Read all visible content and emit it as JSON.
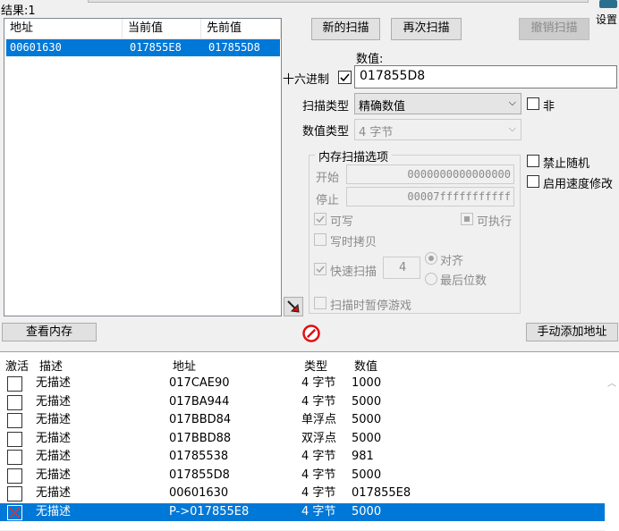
{
  "results_label": "结果:1",
  "settings_label": "设置",
  "found_list": {
    "columns": [
      "地址",
      "当前值",
      "先前值"
    ],
    "rows": [
      {
        "address": "00601630",
        "current": "017855E8",
        "previous": "017855D8"
      }
    ]
  },
  "buttons": {
    "new_scan": "新的扫描",
    "next_scan": "再次扫描",
    "undo_scan": "撤销扫描",
    "view_memory": "查看内存",
    "add_address_manually": "手动添加地址"
  },
  "value": {
    "label": "数值:",
    "hex_label": "十六进制",
    "hex_checked": true,
    "input": "017855D8"
  },
  "scan_type": {
    "label": "扫描类型",
    "selected": "精确数值",
    "not_label": "非"
  },
  "value_type": {
    "label": "数值类型",
    "selected": "4 字节"
  },
  "memory_options": {
    "title": "内存扫描选项",
    "start_label": "开始",
    "start_value": "0000000000000000",
    "stop_label": "停止",
    "stop_value": "00007fffffffffff",
    "writable_label": "可写",
    "executable_label": "可执行",
    "copy_on_write_label": "写时拷贝",
    "fast_scan_label": "快速扫描",
    "fast_scan_value": "4",
    "align_label": "对齐",
    "last_digits_label": "最后位数",
    "pause_game_label": "扫描时暂停游戏"
  },
  "side_options": {
    "disable_random": "禁止随机",
    "enable_speedhack": "启用速度修改"
  },
  "address_table": {
    "columns": [
      "激活",
      "描述",
      "地址",
      "类型",
      "数值"
    ],
    "rows": [
      {
        "description": "无描述",
        "address": "017CAE90",
        "type": "4 字节",
        "value": "1000",
        "selected": false
      },
      {
        "description": "无描述",
        "address": "017BA944",
        "type": "4 字节",
        "value": "5000",
        "selected": false
      },
      {
        "description": "无描述",
        "address": "017BBD84",
        "type": "单浮点",
        "value": "5000",
        "selected": false
      },
      {
        "description": "无描述",
        "address": "017BBD88",
        "type": "双浮点",
        "value": "5000",
        "selected": false
      },
      {
        "description": "无描述",
        "address": "01785538",
        "type": "4 字节",
        "value": "981",
        "selected": false
      },
      {
        "description": "无描述",
        "address": "017855D8",
        "type": "4 字节",
        "value": "5000",
        "selected": false
      },
      {
        "description": "无描述",
        "address": "00601630",
        "type": "4 字节",
        "value": "017855E8",
        "selected": false
      },
      {
        "description": "无描述",
        "address": "P->017855E8",
        "type": "4 字节",
        "value": "5000",
        "selected": true
      }
    ]
  }
}
